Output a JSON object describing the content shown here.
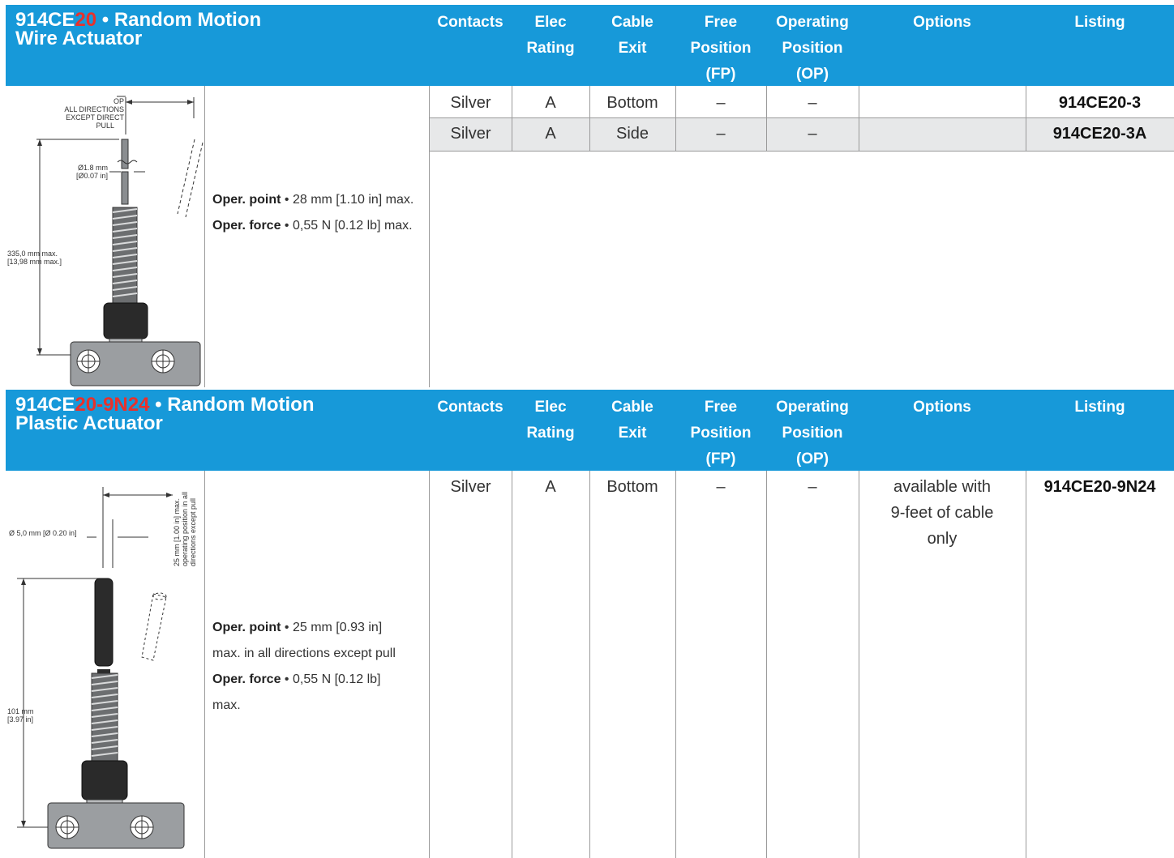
{
  "columns": [
    "Contacts",
    "Elec Rating",
    "Cable Exit",
    "Free Position (FP)",
    "Operating Position (OP)",
    "Options",
    "Listing"
  ],
  "sections": [
    {
      "title_prefix": "914CE",
      "title_highlight": "20",
      "title_suffix": " • Random Motion",
      "title_line2": "Wire Actuator",
      "drawing": {
        "label_op": "OP",
        "label_dirs1": "ALL DIRECTIONS",
        "label_dirs2": "EXCEPT DIRECT",
        "label_dirs3": "PULL",
        "label_dia1": "Ø1.8 mm",
        "label_dia2": "[Ø0.07 in]",
        "label_len1": "335,0 mm max.",
        "label_len2": "[13,98 mm max.]"
      },
      "spec": {
        "point_label": "Oper. point",
        "point_value": "28 mm [1.10 in] max.",
        "force_label": "Oper. force",
        "force_value": "0,55 N [0.12 lb] max."
      },
      "rows": [
        {
          "contacts": "Silver",
          "elec": "A",
          "cable": "Bottom",
          "fp": "–",
          "op": "–",
          "options": "",
          "listing": "914CE20-3"
        },
        {
          "contacts": "Silver",
          "elec": "A",
          "cable": "Side",
          "fp": "–",
          "op": "–",
          "options": "",
          "listing": "914CE20-3A"
        }
      ]
    },
    {
      "title_prefix": "914CE",
      "title_highlight": "20-9N24",
      "title_suffix": " • Random Motion",
      "title_line2": "Plastic Actuator",
      "drawing": {
        "label_top": "25 mm [1.00 in] max.",
        "label_top2": "operating position in all",
        "label_top3": "directions except pull",
        "label_dia": "Ø 5,0 mm [Ø 0.20 in]",
        "label_len1": "101 mm",
        "label_len2": "[3.97 in]"
      },
      "spec": {
        "point_label": "Oper. point",
        "point_value_1": "25 mm [0.93 in]",
        "point_value_2": "max. in all directions except pull",
        "force_label": "Oper. force",
        "force_value_1": "0,55 N [0.12 lb]",
        "force_value_2": "max."
      },
      "rows": [
        {
          "contacts": "Silver",
          "elec": "A",
          "cable": "Bottom",
          "fp": "–",
          "op": "–",
          "options_1": "available with",
          "options_2": "9-feet of cable",
          "options_3": "only",
          "listing": "914CE20-9N24"
        }
      ]
    }
  ]
}
